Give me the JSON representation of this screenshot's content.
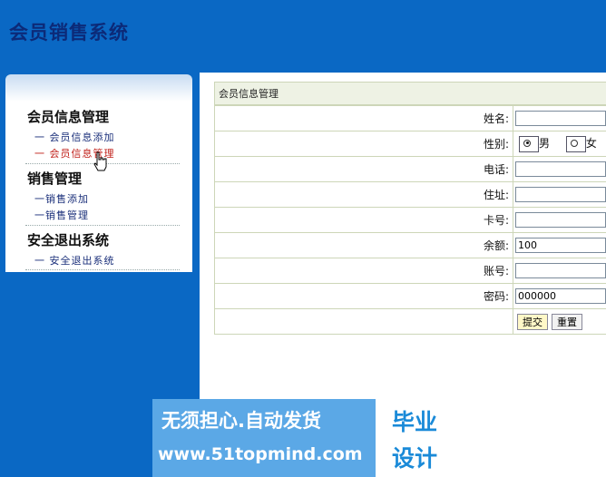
{
  "app": {
    "title": "会员销售系统"
  },
  "sidebar": {
    "sections": [
      {
        "heading": "会员信息管理",
        "items": [
          {
            "label": "一  会员信息添加"
          },
          {
            "label": "一  会员信息管理"
          }
        ]
      },
      {
        "heading": "销售管理",
        "items": [
          {
            "label": "一销售添加"
          },
          {
            "label": "一销售管理"
          }
        ]
      },
      {
        "heading": "安全退出系统",
        "items": [
          {
            "label": "一  安全退出系统"
          }
        ]
      }
    ]
  },
  "main": {
    "panel_title": "会员信息管理",
    "form": {
      "name_label": "姓名:",
      "gender_label": "性别:",
      "gender_male": "男",
      "gender_female": "女",
      "phone_label": "电话:",
      "address_label": "住址:",
      "card_label": "卡号:",
      "balance_label": "余额:",
      "balance_value": "100",
      "account_label": "账号:",
      "password_label": "密码:",
      "password_value": "000000",
      "submit_label": "提交",
      "reset_label": "重置"
    }
  },
  "banner": {
    "slogan": "无须担心.自动发货",
    "url": "www.51topmind.com",
    "badge_line1": "毕业",
    "badge_line2": "设计"
  },
  "colors": {
    "background": "#0a68c4",
    "title": "#0c2a78",
    "active_link": "#c0201a"
  }
}
